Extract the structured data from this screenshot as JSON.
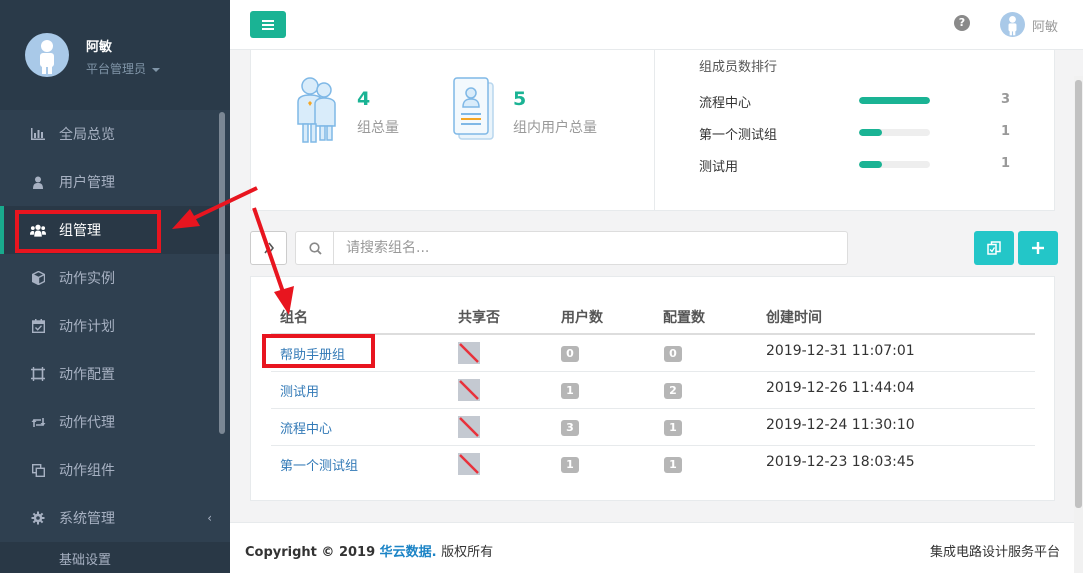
{
  "profile": {
    "name": "阿敏",
    "role": "平台管理员"
  },
  "sidebar": {
    "items": [
      {
        "label": "全局总览",
        "icon": "bar-chart-icon"
      },
      {
        "label": "用户管理",
        "icon": "user-icon"
      },
      {
        "label": "组管理",
        "icon": "users-icon",
        "active": true
      },
      {
        "label": "动作实例",
        "icon": "cube-icon"
      },
      {
        "label": "动作计划",
        "icon": "calendar-check-icon"
      },
      {
        "label": "动作配置",
        "icon": "frame-icon"
      },
      {
        "label": "动作代理",
        "icon": "retweet-icon"
      },
      {
        "label": "动作组件",
        "icon": "clone-icon"
      },
      {
        "label": "系统管理",
        "icon": "gear-icon"
      }
    ],
    "sub_items": [
      {
        "label": "基础设置"
      }
    ],
    "arrow": "‹"
  },
  "topbar": {
    "user_name": "阿敏",
    "help": "?"
  },
  "stats": {
    "group_count": "4",
    "group_count_label": "组总量",
    "user_count": "5",
    "user_count_label": "组内用户总量",
    "ranking_title": "组成员数排行",
    "ranking": [
      {
        "name": "流程中心",
        "value": "3",
        "fraction": 1.0
      },
      {
        "name": "第一个测试组",
        "value": "1",
        "fraction": 0.33
      },
      {
        "name": "测试用",
        "value": "1",
        "fraction": 0.33
      }
    ]
  },
  "search": {
    "placeholder": "请搜索组名..."
  },
  "table": {
    "headers": [
      "组名",
      "共享否",
      "用户数",
      "配置数",
      "创建时间"
    ],
    "rows": [
      {
        "name": "帮助手册组",
        "users": "0",
        "configs": "0",
        "created": "2019-12-31 11:07:01"
      },
      {
        "name": "测试用",
        "users": "1",
        "configs": "2",
        "created": "2019-12-26 11:44:04"
      },
      {
        "name": "流程中心",
        "users": "3",
        "configs": "1",
        "created": "2019-12-24 11:30:10"
      },
      {
        "name": "第一个测试组",
        "users": "1",
        "configs": "1",
        "created": "2019-12-23 18:03:45"
      }
    ]
  },
  "footer": {
    "copyright_prefix": "Copyright © 2019",
    "brand": "华云数据.",
    "rights": "版权所有",
    "right_text": "集成电路设计服务平台"
  },
  "colors": {
    "accent": "#1ab394",
    "info": "#23c6c8",
    "sidebar": "#2f4050",
    "annotation": "#e8151f",
    "link": "#337ab7"
  }
}
